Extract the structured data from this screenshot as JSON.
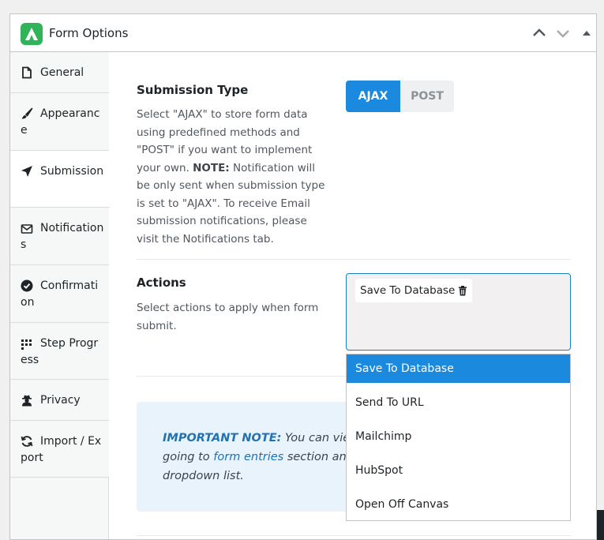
{
  "panel": {
    "title": "Form Options"
  },
  "header_controls": [
    "chevron-up-icon",
    "chevron-down-icon",
    "triangle-up-icon"
  ],
  "sidebar": {
    "active_index": 2,
    "tabs": [
      {
        "label": "General",
        "icon": "document-icon"
      },
      {
        "label": "Appearance",
        "icon": "paintbrush-icon"
      },
      {
        "label": "Submission",
        "icon": "paper-plane-icon"
      },
      {
        "label": "Notifications",
        "icon": "envelope-icon"
      },
      {
        "label": "Confirmation",
        "icon": "check-circle-icon"
      },
      {
        "label": "Step Progress",
        "icon": "step-progress-icon"
      },
      {
        "label": "Privacy",
        "icon": "user-secret-icon"
      },
      {
        "label": "Import / Export",
        "icon": "sync-icon"
      }
    ]
  },
  "submission_type": {
    "title": "Submission Type",
    "desc_1": "Select \"AJAX\" to store form data using predefined methods and \"POST\" if you want to implement your own. ",
    "desc_bold": "NOTE:",
    "desc_2": " Notification will be only sent when submission type is set to \"AJAX\". To receive Email submission notifications, please visit the Notifications tab.",
    "options": [
      "AJAX",
      "POST"
    ],
    "selected": "AJAX"
  },
  "actions": {
    "title": "Actions",
    "desc": "Select actions to apply when form submit.",
    "selected": [
      "Save To Database"
    ],
    "dropdown_options": [
      "Save To Database",
      "Send To URL",
      "Mailchimp",
      "HubSpot",
      "Open Off Canvas"
    ],
    "highlighted": "Save To Database"
  },
  "note": {
    "label": "IMPORTANT NOTE:",
    "line1_rest": " You can view",
    "line2_pre": "going to ",
    "link": "form entries",
    "line2_post": " section and",
    "line3": "dropdown list."
  },
  "colors": {
    "accent": "#1a89de",
    "logo": "#2fb45a",
    "note_bg": "#e8f3fb",
    "link": "#2271b1"
  }
}
